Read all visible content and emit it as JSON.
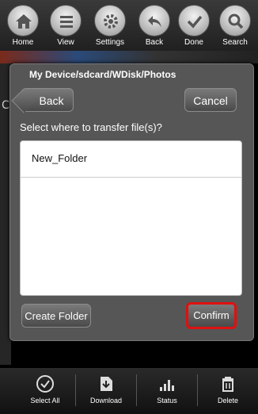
{
  "top_toolbar": {
    "items": [
      {
        "label": "Home",
        "icon": "home-icon"
      },
      {
        "label": "View",
        "icon": "list-icon"
      },
      {
        "label": "Settings",
        "icon": "gear-icon"
      },
      {
        "label": "Back",
        "icon": "back-arrow-icon"
      },
      {
        "label": "Done",
        "icon": "checkmark-icon"
      },
      {
        "label": "Search",
        "icon": "search-icon"
      }
    ]
  },
  "dialog": {
    "title": "My Device/sdcard/WDisk/Photos",
    "back_label": "Back",
    "cancel_label": "Cancel",
    "prompt": "Select where to transfer file(s)?",
    "folders": [
      {
        "name": "New_Folder"
      }
    ],
    "create_folder_label": "Create Folder",
    "confirm_label": "Confirm",
    "confirm_highlight_color": "#e01010"
  },
  "background": {
    "left_edge_char": "C"
  },
  "bottom_toolbar": {
    "items": [
      {
        "label": "Select All",
        "icon": "check-circle-icon"
      },
      {
        "label": "Download",
        "icon": "download-icon"
      },
      {
        "label": "Status",
        "icon": "bar-chart-icon"
      },
      {
        "label": "Delete",
        "icon": "trash-icon"
      }
    ]
  }
}
